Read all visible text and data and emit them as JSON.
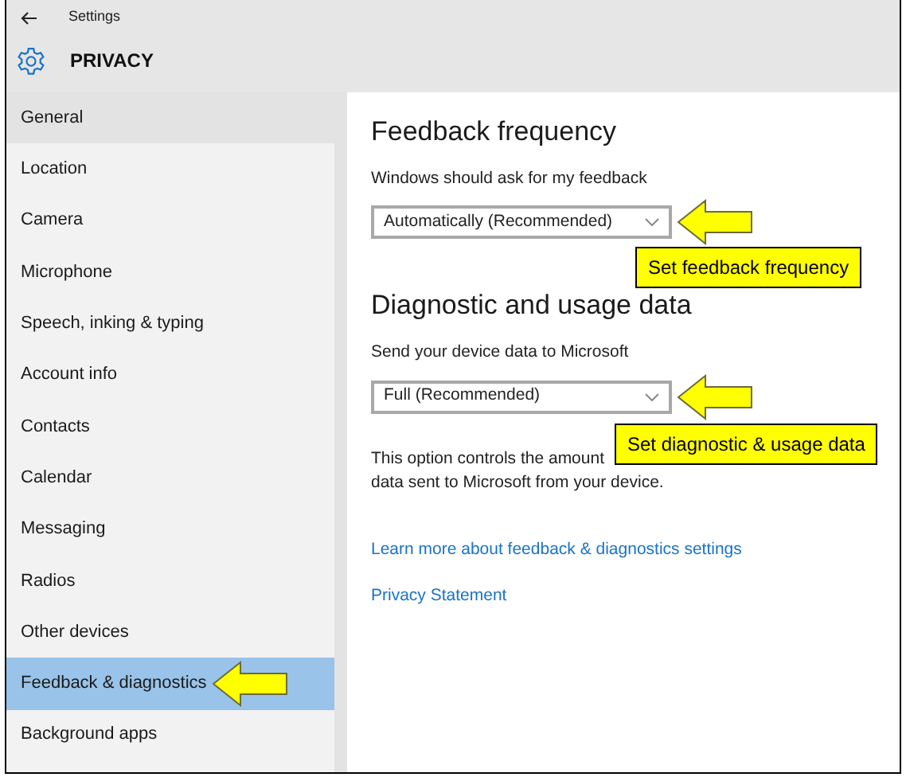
{
  "window": {
    "title": "Settings"
  },
  "page_title": "PRIVACY",
  "sidebar": {
    "items": [
      {
        "label": "General",
        "selected": false,
        "hover": true
      },
      {
        "label": "Location",
        "selected": false,
        "hover": false
      },
      {
        "label": "Camera",
        "selected": false,
        "hover": false
      },
      {
        "label": "Microphone",
        "selected": false,
        "hover": false
      },
      {
        "label": "Speech, inking & typing",
        "selected": false,
        "hover": false
      },
      {
        "label": "Account info",
        "selected": false,
        "hover": false
      },
      {
        "label": "Contacts",
        "selected": false,
        "hover": false
      },
      {
        "label": "Calendar",
        "selected": false,
        "hover": false
      },
      {
        "label": "Messaging",
        "selected": false,
        "hover": false
      },
      {
        "label": "Radios",
        "selected": false,
        "hover": false
      },
      {
        "label": "Other devices",
        "selected": false,
        "hover": false
      },
      {
        "label": "Feedback & diagnostics",
        "selected": true,
        "hover": false
      },
      {
        "label": "Background apps",
        "selected": false,
        "hover": false
      }
    ]
  },
  "sections": [
    {
      "heading": "Feedback frequency",
      "label": "Windows should ask for my feedback",
      "dropdown": "Automatically (Recommended)",
      "callout": "Set feedback frequency"
    },
    {
      "heading": "Diagnostic and usage data",
      "label": "Send your device data to Microsoft",
      "dropdown": "Full (Recommended)",
      "callout": "Set diagnostic & usage data",
      "description": [
        "This option controls the amount",
        "data sent to Microsoft from your device."
      ]
    }
  ],
  "links": [
    "Learn more about feedback & diagnostics settings",
    "Privacy Statement"
  ]
}
